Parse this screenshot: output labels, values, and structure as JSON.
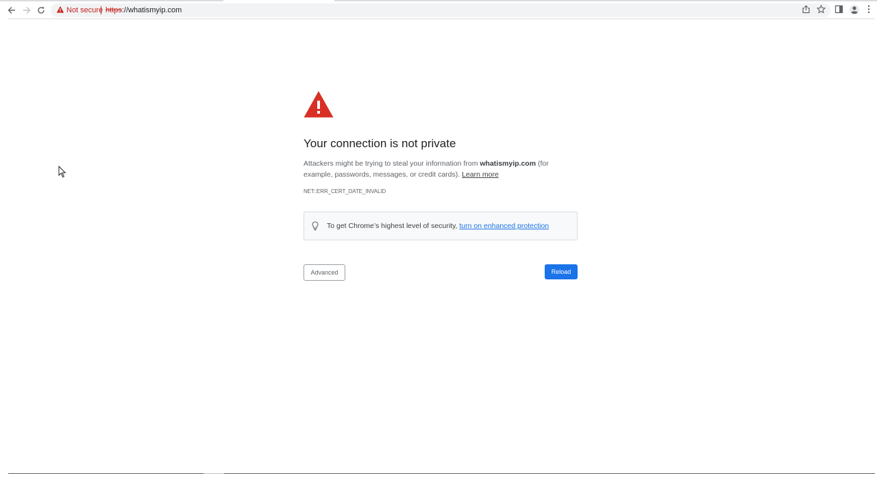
{
  "browser": {
    "security_label": "Not secure",
    "url_scheme": "https",
    "url_rest": "://whatismyip.com",
    "icons": {
      "back": "arrow-left-icon",
      "forward": "arrow-right-icon",
      "reload": "reload-icon",
      "security": "warning-triangle-icon",
      "share": "share-icon",
      "bookmark": "star-icon",
      "side_panel": "side-panel-icon",
      "profile": "profile-icon",
      "menu": "kebab-menu-icon"
    }
  },
  "page": {
    "heading": "Your connection is not private",
    "message_prefix": "Attackers might be trying to steal your information from ",
    "message_domain": "whatismyip.com",
    "message_suffix": " (for example, passwords, messages, or credit cards). ",
    "learn_more": "Learn more",
    "error_code": "NET::ERR_CERT_DATE_INVALID",
    "promo_text": "To get Chrome’s highest level of security, ",
    "promo_link": "turn on enhanced protection",
    "advanced_label": "Advanced",
    "reload_label": "Reload"
  },
  "colors": {
    "warning_red": "#d93025",
    "link_blue": "#1a73e8",
    "button_blue": "#1a73e8"
  }
}
